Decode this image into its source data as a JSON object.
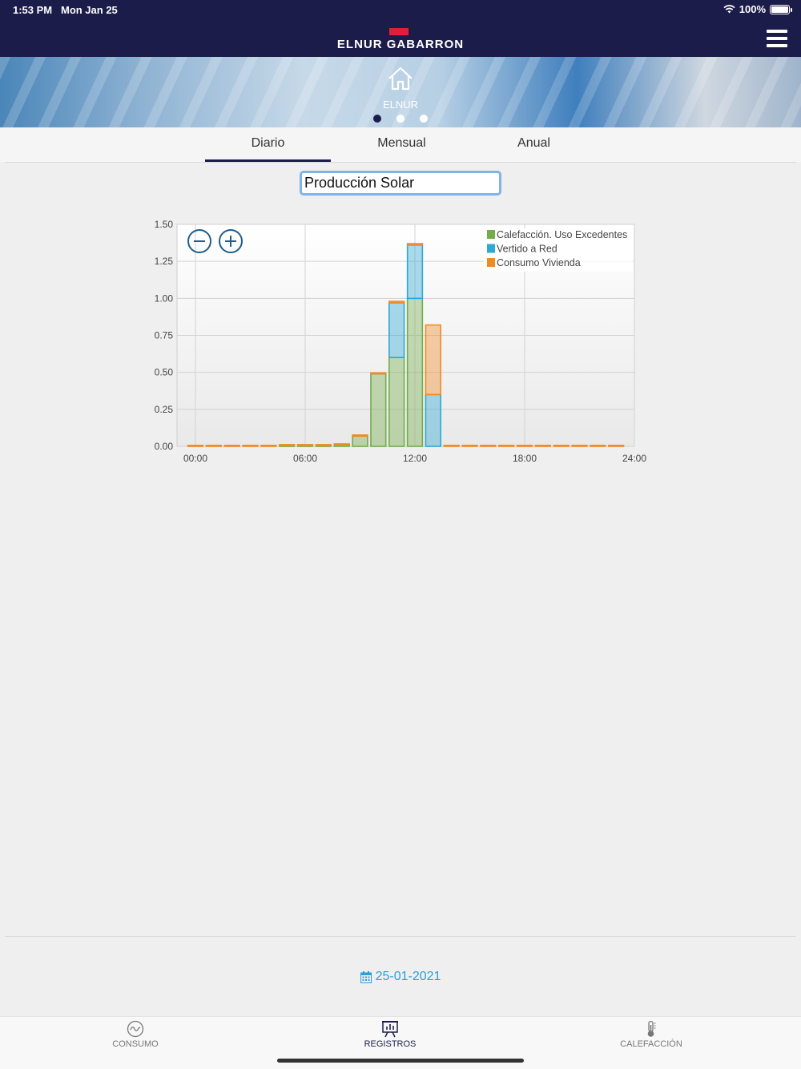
{
  "status": {
    "time": "1:53 PM",
    "date": "Mon Jan 25",
    "battery": "100%"
  },
  "brand": {
    "name": "ELNUR GABARRON"
  },
  "hero": {
    "label": "ELNUR",
    "pages": 3,
    "active_page": 1
  },
  "tabs": [
    {
      "label": "Diario",
      "active": true
    },
    {
      "label": "Mensual",
      "active": false
    },
    {
      "label": "Anual",
      "active": false
    }
  ],
  "selector": {
    "value": "Producción Solar"
  },
  "chart_data": {
    "type": "bar",
    "stacked": true,
    "xlabel": "",
    "ylabel": "",
    "ylim": [
      0,
      1.5
    ],
    "yticks": [
      "0.00",
      "0.25",
      "0.50",
      "0.75",
      "1.00",
      "1.25",
      "1.50"
    ],
    "xticks": [
      "00:00",
      "06:00",
      "12:00",
      "18:00",
      "24:00"
    ],
    "grid": true,
    "legend_position": "top-right",
    "categories": [
      "00",
      "01",
      "02",
      "03",
      "04",
      "05",
      "06",
      "07",
      "08",
      "09",
      "10",
      "11",
      "12",
      "13",
      "14",
      "15",
      "16",
      "17",
      "18",
      "19",
      "20",
      "21",
      "22",
      "23"
    ],
    "series": [
      {
        "name": "Calefacción. Uso Excedentes",
        "color": "#72ad4a",
        "values": [
          0,
          0,
          0,
          0,
          0,
          0.005,
          0.005,
          0.005,
          0.01,
          0.07,
          0.49,
          0.6,
          1.0,
          0,
          0,
          0,
          0,
          0,
          0,
          0,
          0,
          0,
          0,
          0
        ]
      },
      {
        "name": "Vertido a Red",
        "color": "#2ea8d4",
        "values": [
          0,
          0,
          0,
          0,
          0,
          0,
          0,
          0,
          0,
          0,
          0,
          0.37,
          0.36,
          0.35,
          0,
          0,
          0,
          0,
          0,
          0,
          0,
          0,
          0,
          0
        ]
      },
      {
        "name": "Consumo Vivienda",
        "color": "#f08a24",
        "values": [
          0.005,
          0.005,
          0.005,
          0.005,
          0.005,
          0.005,
          0.005,
          0.005,
          0.005,
          0.005,
          0.005,
          0.01,
          0.01,
          0.47,
          0.005,
          0.005,
          0.005,
          0.005,
          0.005,
          0.005,
          0.005,
          0.005,
          0.005,
          0.005
        ]
      }
    ]
  },
  "zoom": {
    "out_icon": "zoom-out-icon",
    "in_icon": "zoom-in-icon"
  },
  "date_picker": {
    "value": "25-01-2021",
    "icon": "calendar-icon"
  },
  "tabbar": [
    {
      "label": "CONSUMO",
      "icon": "consumption-icon",
      "active": false
    },
    {
      "label": "REGISTROS",
      "icon": "records-icon",
      "active": true
    },
    {
      "label": "CALEFACCIÓN",
      "icon": "thermometer-icon",
      "active": false
    }
  ]
}
